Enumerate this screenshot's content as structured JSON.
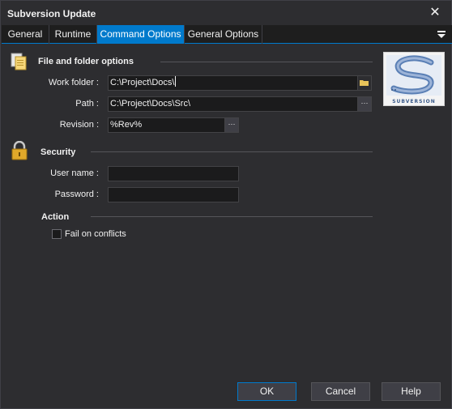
{
  "window": {
    "title": "Subversion Update"
  },
  "tabs": [
    {
      "label": "General"
    },
    {
      "label": "Runtime"
    },
    {
      "label": "Command Options"
    },
    {
      "label": "General Options"
    }
  ],
  "active_tab": "Command Options",
  "file_folder": {
    "title": "File and folder options",
    "work_folder_label": "Work folder :",
    "work_folder_value": "C:\\Project\\Docs\\",
    "path_label": "Path :",
    "path_value": "C:\\Project\\Docs\\Src\\",
    "revision_label": "Revision :",
    "revision_value": "%Rev%"
  },
  "security": {
    "title": "Security",
    "username_label": "User name :",
    "username_value": "",
    "password_label": "Password :",
    "password_value": ""
  },
  "action": {
    "title": "Action",
    "fail_on_conflicts_label": "Fail on conflicts",
    "fail_on_conflicts_checked": false
  },
  "logo": {
    "text": "SUBVERSION"
  },
  "buttons": {
    "ok": "OK",
    "cancel": "Cancel",
    "help": "Help"
  },
  "icons": {
    "close": "close-icon",
    "overflow": "tab-overflow-icon",
    "files": "files-icon",
    "lock": "lock-icon",
    "folder": "folder-icon",
    "ellipsis": "ellipsis-icon"
  },
  "colors": {
    "accent": "#007acc",
    "background": "#2d2d30",
    "input_bg": "#1b1b1c"
  }
}
